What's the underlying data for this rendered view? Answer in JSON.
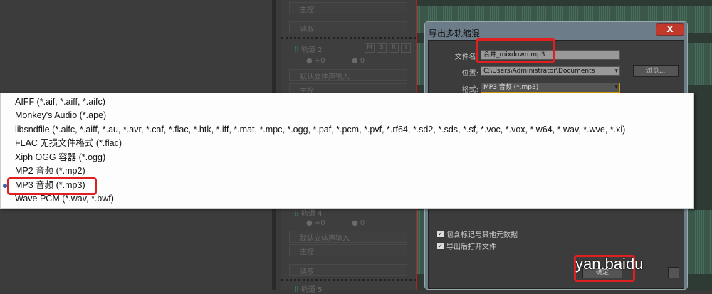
{
  "tracks": {
    "master": "主控",
    "read": "读取",
    "input": "默认立体声输入",
    "track2": "轨道 2",
    "track4": "轨道 4",
    "track5": "轨道 5",
    "msri": [
      "M",
      "S",
      "R",
      "I"
    ],
    "vol": "+0",
    "pan": "0"
  },
  "dialog": {
    "title": "导出多轨缩混",
    "close": "X",
    "filename_label": "文件名:",
    "filename": "合并_mixdown.mp3",
    "location_label": "位置:",
    "location": "C:\\Users\\Administrator\\Documents",
    "browse": "浏览...",
    "format_label": "格式:",
    "format": "MP3 音频 (*.mp3)",
    "include_markers": "包含标记与其他元数据",
    "open_after": "导出后打开文件",
    "ok": "确定"
  },
  "format_list": [
    "AIFF (*.aif, *.aiff, *.aifc)",
    "Monkey's Audio (*.ape)",
    "libsndfile (*.aifc, *.aiff, *.au, *.avr, *.caf, *.flac, *.htk, *.iff, *.mat, *.mpc, *.ogg, *.paf, *.pcm, *.pvf, *.rf64, *.sd2, *.sds, *.sf, *.voc, *.vox, *.w64, *.wav, *.wve, *.xi)",
    "FLAC 无损文件格式 (*.flac)",
    "Xiph OGG 容器 (*.ogg)",
    "MP2 音频 (*.mp2)",
    "MP3 音频 (*.mp3)",
    "Wave PCM (*.wav, *.bwf)"
  ],
  "watermark": "yan.baidu"
}
